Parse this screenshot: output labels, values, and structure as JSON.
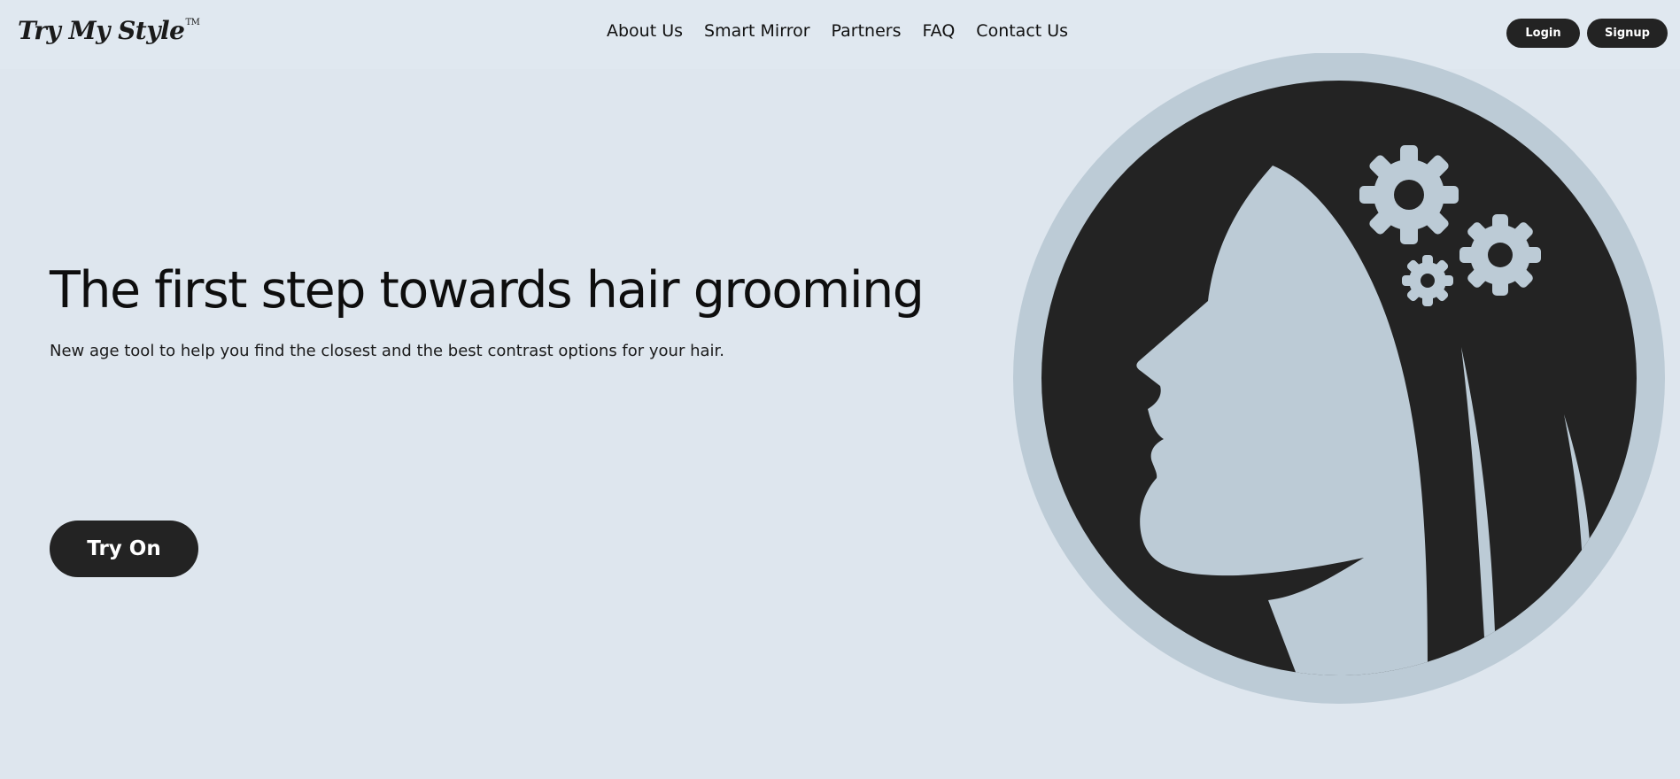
{
  "brand": {
    "name": "Try My Style",
    "trademark": "TM"
  },
  "nav": {
    "items": [
      "About Us",
      "Smart Mirror",
      "Partners",
      "FAQ",
      "Contact Us"
    ]
  },
  "auth": {
    "login_label": "Login",
    "signup_label": "Signup"
  },
  "hero": {
    "title": "The first step towards hair grooming",
    "subtitle": "New age tool to help you find the closest and the best contrast options for your hair.",
    "cta_label": "Try On",
    "illustration": "woman-profile-with-gears-icon"
  },
  "colors": {
    "background": "#dee6ee",
    "dark": "#232323",
    "accent_light": "#bccbd6"
  }
}
